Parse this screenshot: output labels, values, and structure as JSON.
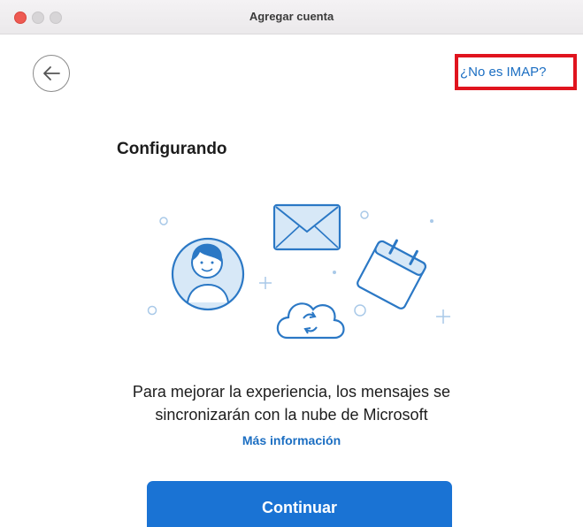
{
  "window": {
    "title": "Agregar cuenta"
  },
  "nav": {
    "back_icon": "arrow-left-icon",
    "not_imap_link": "¿No es IMAP?"
  },
  "main": {
    "heading": "Configurando",
    "message_line1": "Para mejorar la experiencia, los mensajes se",
    "message_line2": "sincronizarán con la nube de Microsoft",
    "more_info_link": "Más información",
    "continue_button": "Continuar"
  },
  "colors": {
    "accent": "#1a73d4",
    "link": "#1b6ec2",
    "highlight": "#e0141e",
    "illustration_stroke": "#2b78c5",
    "illustration_fill": "#d7e8f7"
  }
}
